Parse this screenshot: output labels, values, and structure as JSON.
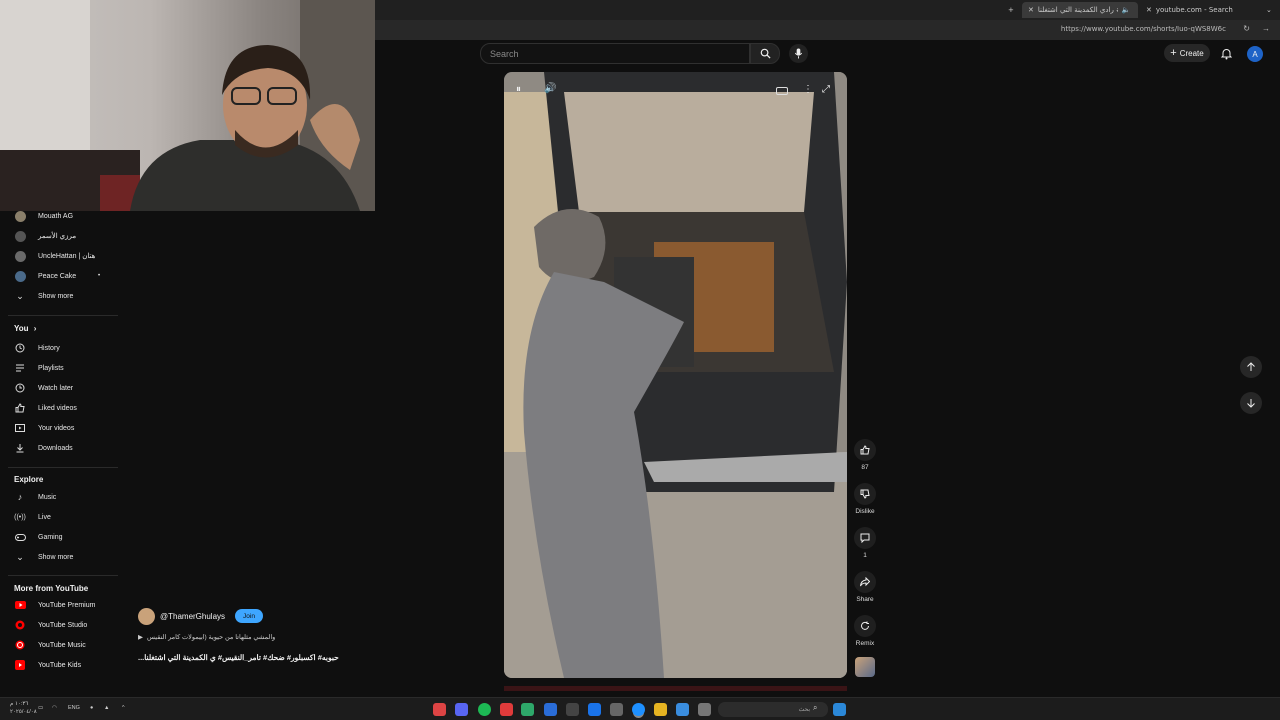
{
  "browser": {
    "tabs": [
      {
        "title": "رادي الكمدينة التي اشتغلنا ‪#ع"
      },
      {
        "title": "youtube.com - Search"
      }
    ],
    "url": "https://www.youtube.com/shorts/Iuo-qWS8W6c"
  },
  "header": {
    "search_placeholder": "Search",
    "create_label": "Create",
    "avatar_letter": "A"
  },
  "sidebar": {
    "subscriptions": [
      {
        "label": "Mouath AG",
        "color": "#8a7f6a"
      },
      {
        "label": "مرزي الأسمر",
        "color": "#555555"
      },
      {
        "label": "UncleHattan | هتان",
        "color": "#6a6a6a"
      },
      {
        "label": "Peace Cake",
        "color": "#4a6a8a"
      }
    ],
    "subs_show_more": "Show more",
    "you_heading": "You",
    "you_items": [
      {
        "label": "History",
        "icon": "history-icon"
      },
      {
        "label": "Playlists",
        "icon": "playlists-icon"
      },
      {
        "label": "Watch later",
        "icon": "clock-icon"
      },
      {
        "label": "Liked videos",
        "icon": "thumbs-up-icon"
      },
      {
        "label": "Your videos",
        "icon": "video-icon"
      },
      {
        "label": "Downloads",
        "icon": "download-icon"
      }
    ],
    "explore_heading": "Explore",
    "explore_items": [
      {
        "label": "Music",
        "icon": "music-icon"
      },
      {
        "label": "Live",
        "icon": "live-icon"
      },
      {
        "label": "Gaming",
        "icon": "gaming-icon"
      }
    ],
    "explore_show_more": "Show more",
    "more_heading": "More from YouTube",
    "more_items": [
      {
        "label": "YouTube Premium"
      },
      {
        "label": "YouTube Studio"
      },
      {
        "label": "YouTube Music"
      },
      {
        "label": "YouTube Kids"
      }
    ]
  },
  "short": {
    "channel": "@ThamerGhulays",
    "join_label": "Join",
    "music": "والمشي مثلهاتا من حيوية (ابيمولات كامر النقيس",
    "title": "...ي الكمدينة التي اشتغلنا ‪#تامر_النقيس ‪#ضحك ‪#اكسبلور ‪#حبوبه"
  },
  "actions": {
    "like_count": "87",
    "dislike_label": "Dislike",
    "comment_count": "1",
    "share_label": "Share",
    "remix_label": "Remix"
  },
  "taskbar": {
    "search_placeholder": "بحث",
    "lang": "ENG",
    "clock_line1": "١٠:٣٦ م",
    "clock_line2": "٢٠٢٥/٠٤/٠٨"
  },
  "colors": {
    "accent": "#3ea6ff",
    "yt_red": "#ff0000",
    "background": "#0f0f0f"
  }
}
